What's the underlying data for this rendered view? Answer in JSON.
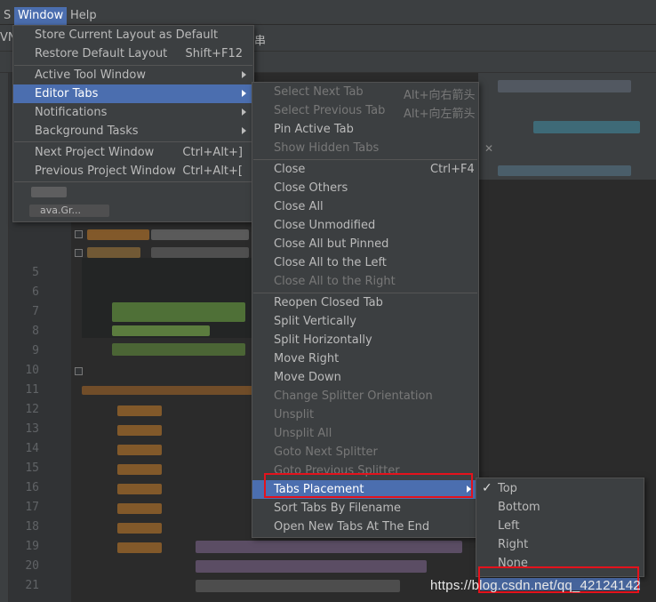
{
  "menubar": {
    "items": [
      {
        "label": "S"
      },
      {
        "label": "Window"
      },
      {
        "label": "Help"
      }
    ]
  },
  "toolbar": {
    "left_fragment": "VN:",
    "glyph": "串"
  },
  "line_numbers": [
    "5",
    "6",
    "7",
    "8",
    "9",
    "10",
    "11",
    "12",
    "13",
    "14",
    "15",
    "16",
    "17",
    "18",
    "19",
    "20",
    "21"
  ],
  "window_menu": {
    "items": [
      {
        "label": "Store Current Layout as Default",
        "shortcut": ""
      },
      {
        "label": "Restore Default Layout",
        "shortcut": "Shift+F12"
      },
      {
        "label": "Active Tool Window",
        "shortcut": ""
      },
      {
        "label": "Editor Tabs",
        "shortcut": ""
      },
      {
        "label": "Notifications",
        "shortcut": ""
      },
      {
        "label": "Background Tasks",
        "shortcut": ""
      },
      {
        "label": "Next Project Window",
        "shortcut": "Ctrl+Alt+]"
      },
      {
        "label": "Previous Project Window",
        "shortcut": "Ctrl+Alt+["
      },
      {
        "label": "ava.Gr..."
      }
    ]
  },
  "editor_tabs_menu": {
    "items": [
      {
        "label": "Select Next Tab",
        "shortcut": "Alt+向右箭头"
      },
      {
        "label": "Select Previous Tab",
        "shortcut": "Alt+向左箭头"
      },
      {
        "label": "Pin Active Tab",
        "shortcut": ""
      },
      {
        "label": "Show Hidden Tabs",
        "shortcut": ""
      },
      {
        "label": "Close",
        "shortcut": "Ctrl+F4"
      },
      {
        "label": "Close Others"
      },
      {
        "label": "Close All"
      },
      {
        "label": "Close Unmodified"
      },
      {
        "label": "Close All but Pinned"
      },
      {
        "label": "Close All to the Left"
      },
      {
        "label": "Close All to the Right"
      },
      {
        "label": "Reopen Closed Tab"
      },
      {
        "label": "Split Vertically"
      },
      {
        "label": "Split Horizontally"
      },
      {
        "label": "Move Right"
      },
      {
        "label": "Move Down"
      },
      {
        "label": "Change Splitter Orientation"
      },
      {
        "label": "Unsplit"
      },
      {
        "label": "Unsplit All"
      },
      {
        "label": "Goto Next Splitter"
      },
      {
        "label": "Goto Previous Splitter"
      },
      {
        "label": "Tabs Placement"
      },
      {
        "label": "Sort Tabs By Filename"
      },
      {
        "label": "Open New Tabs At The End"
      }
    ]
  },
  "placement_menu": {
    "check": "✓",
    "items": [
      {
        "label": "Top",
        "checked": true
      },
      {
        "label": "Bottom"
      },
      {
        "label": "Left"
      },
      {
        "label": "Right"
      },
      {
        "label": "None"
      }
    ]
  },
  "watermark": "https://blog.csdn.net/qq_42124142",
  "colors": {
    "highlight": "#4b6eaf",
    "annotation": "#e4121c"
  }
}
